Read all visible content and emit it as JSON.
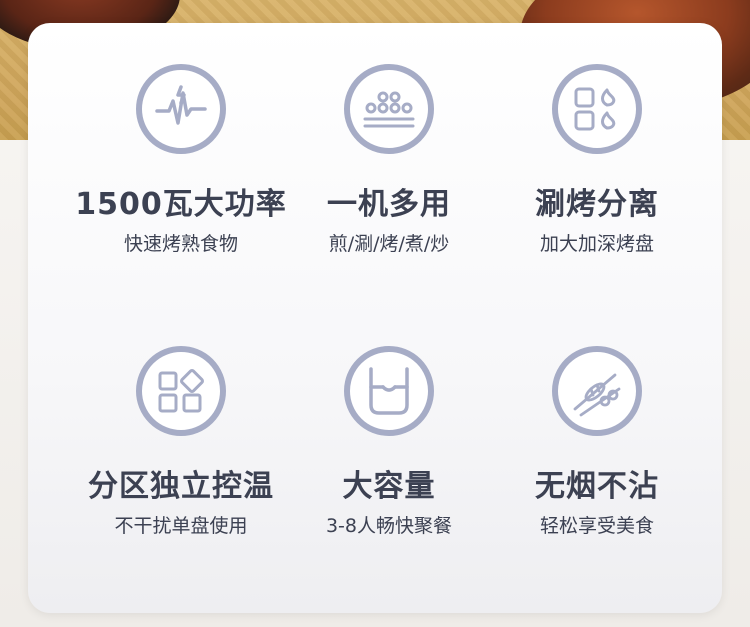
{
  "features": [
    {
      "icon": "power-pulse-icon",
      "title": "1500瓦大功率",
      "subtitle": "快速烤熟食物"
    },
    {
      "icon": "multi-dots-tray-icon",
      "title": "一机多用",
      "subtitle": "煎/涮/烤/煮/炒"
    },
    {
      "icon": "grill-flame-grid-icon",
      "title": "涮烤分离",
      "subtitle": "加大加深烤盘"
    },
    {
      "icon": "zone-blocks-icon",
      "title": "分区独立控温",
      "subtitle": "不干扰单盘使用"
    },
    {
      "icon": "capacity-pot-icon",
      "title": "大容量",
      "subtitle": "3-8人畅快聚餐"
    },
    {
      "icon": "skewer-icon",
      "title": "无烟不沾",
      "subtitle": "轻松享受美食"
    }
  ],
  "colors": {
    "icon_ring": "#a6acc6",
    "text": "#3c4152",
    "card": "#ffffff"
  }
}
